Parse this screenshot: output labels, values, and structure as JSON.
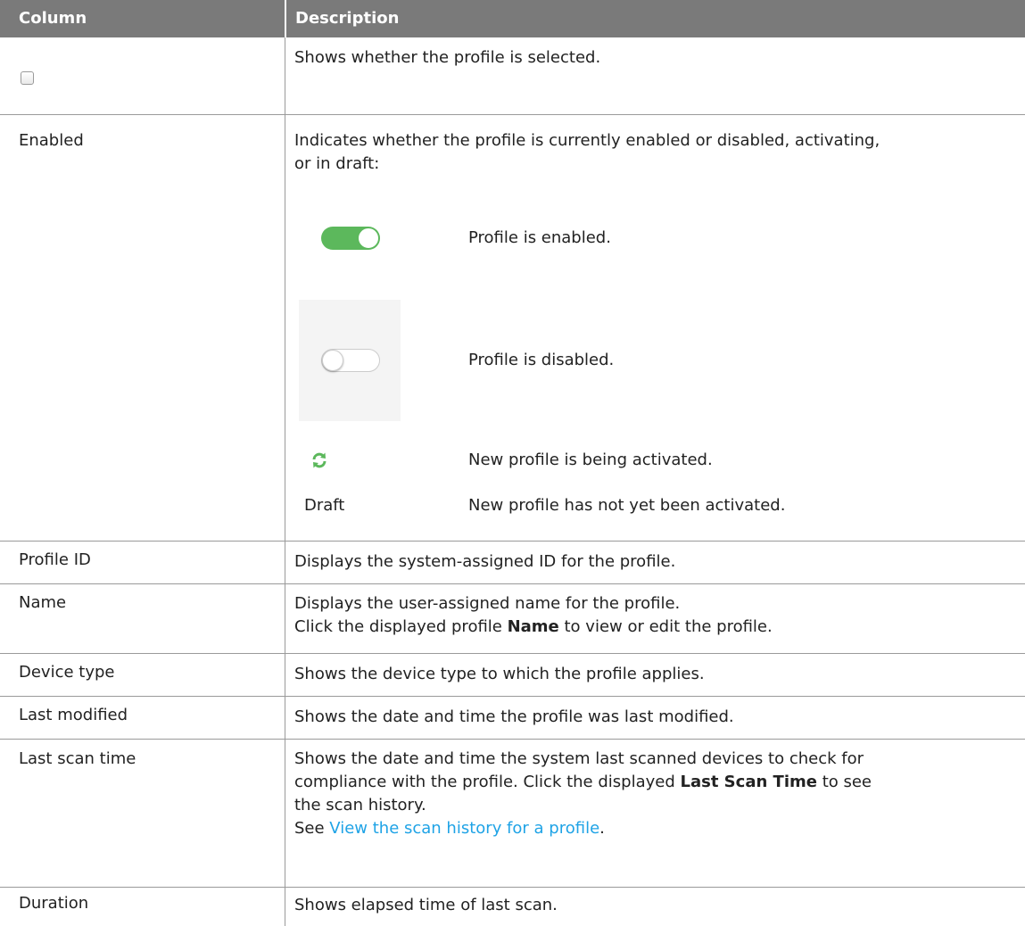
{
  "header": {
    "col1": "Column",
    "col2": "Description"
  },
  "rows": {
    "selected": {
      "description": "Shows whether the profile is selected."
    },
    "enabled": {
      "label": "Enabled",
      "description_line1": "Indicates whether the profile is currently enabled or disabled, activating,",
      "description_line2": "or in draft:",
      "states": [
        {
          "icon": "toggle-on-icon",
          "text": "Profile is enabled."
        },
        {
          "icon": "toggle-off-icon",
          "text": "Profile is disabled."
        },
        {
          "icon": "sync-icon",
          "text": "New profile is being activated."
        },
        {
          "label": "Draft",
          "text": "New profile has not yet been activated."
        }
      ]
    },
    "profile_id": {
      "label": "Profile ID",
      "description": "Displays the system-assigned ID for the profile."
    },
    "name": {
      "label": "Name",
      "line1": "Displays the user-assigned name for the profile.",
      "line2_pre": "Click the displayed profile ",
      "line2_bold": "Name",
      "line2_post": " to view or edit the profile."
    },
    "device_type": {
      "label": "Device type",
      "description": "Shows the device type to which the profile applies."
    },
    "last_modified": {
      "label": "Last modified",
      "description": "Shows the date and time the profile was last modified."
    },
    "last_scan_time": {
      "label": "Last scan time",
      "line1": "Shows the date and time the system last scanned devices to check for",
      "line2_pre": "compliance with the profile. Click the displayed ",
      "line2_bold": "Last Scan Time",
      "line2_post": " to see",
      "line3": "the scan history.",
      "line4_pre": "See ",
      "line4_link": "View the scan history for a profile",
      "line4_post": "."
    },
    "duration": {
      "label": "Duration",
      "description": "Shows elapsed time of last scan."
    }
  },
  "colors": {
    "header_bg": "#7a7a7a",
    "toggle_on": "#5cb85c",
    "link": "#1fa3e6"
  }
}
